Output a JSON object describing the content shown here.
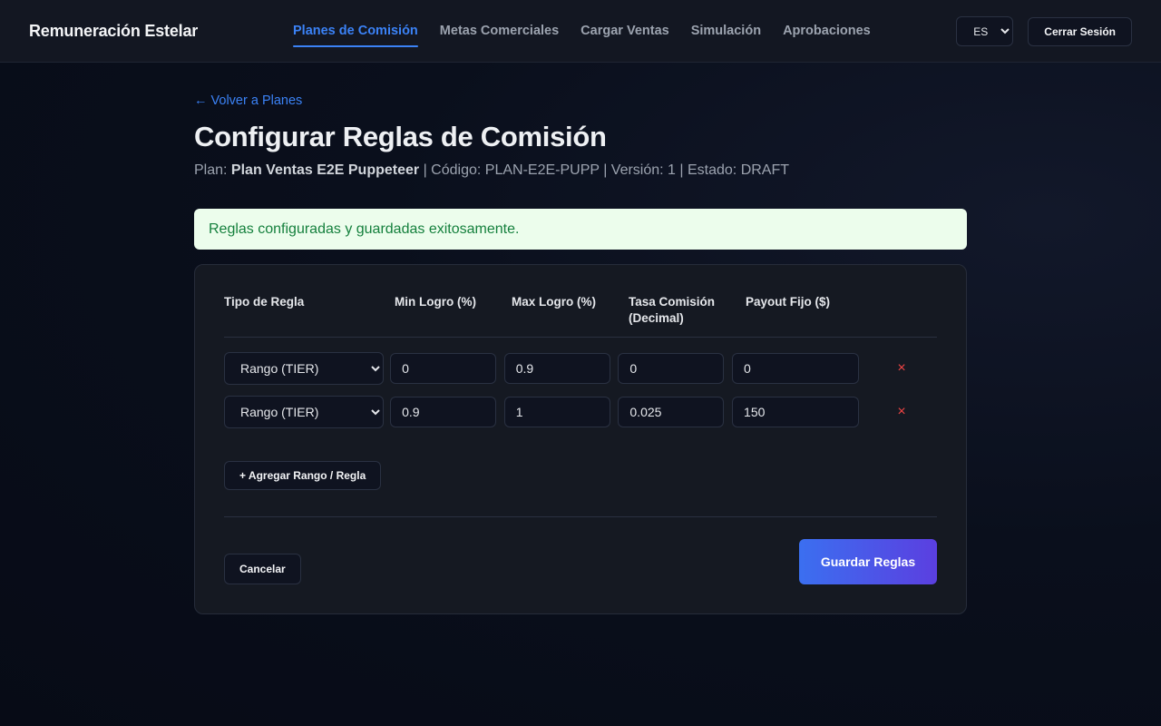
{
  "navbar": {
    "brand": "Remuneración Estelar",
    "links": [
      {
        "label": "Planes de Comisión",
        "active": true
      },
      {
        "label": "Metas Comerciales"
      },
      {
        "label": "Cargar Ventas"
      },
      {
        "label": "Simulación"
      },
      {
        "label": "Aprobaciones"
      }
    ],
    "language": "ES",
    "logout_label": "Cerrar Sesión"
  },
  "page": {
    "back_label": "← Volver a Planes",
    "title": "Configurar Reglas de Comisión",
    "plan_prefix": "Plan: ",
    "plan_name": "Plan Ventas E2E Puppeteer",
    "plan_meta": " | Código: PLAN-E2E-PUPP | Versión: 1 | Estado: DRAFT",
    "alert": "Reglas configuradas y guardadas exitosamente."
  },
  "table": {
    "headers": [
      "Tipo de Regla",
      "Min Logro (%)",
      "Max Logro (%)",
      "Tasa Comisión (Decimal)",
      "Payout Fijo ($)"
    ],
    "rows": [
      {
        "type": "Rango (TIER)",
        "min": "0",
        "max": "0.9",
        "rate": "0",
        "payout": "0"
      },
      {
        "type": "Rango (TIER)",
        "min": "0.9",
        "max": "1",
        "rate": "0.025",
        "payout": "150"
      }
    ],
    "remove_symbol": "×"
  },
  "actions": {
    "add_label": "+ Agregar Rango / Regla",
    "cancel_label": "Cancelar",
    "save_label": "Guardar Reglas"
  },
  "colors": {
    "accent": "#3b82f6",
    "success_bg": "#ecfdec",
    "success_text": "#15803d",
    "danger": "#ef4444"
  }
}
